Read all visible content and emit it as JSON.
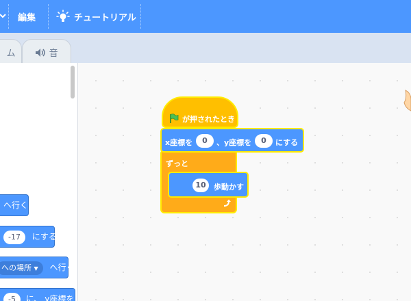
{
  "menu": {
    "edit_label": "編集",
    "tutorial_label": "チュートリアル"
  },
  "tabs": {
    "costume_label_partial": "ム",
    "sound_label": "音"
  },
  "palette": {
    "goto_partial": "へ行く",
    "set_value": "-17",
    "set_suffix": "にする",
    "random_dropdown": "への場所",
    "random_suffix": "へ行く",
    "glide_value": "-5",
    "glide_text": "に、 y座標を"
  },
  "script": {
    "hat_label": "が押されたとき",
    "goto_x_label": "x座標を",
    "goto_x_value": "0",
    "goto_sep": "、y座標を",
    "goto_y_value": "0",
    "goto_suffix": "にする",
    "forever_label": "ずっと",
    "move_value": "10",
    "move_label": "歩動かす"
  },
  "colors": {
    "menubar": "#4c97ff",
    "motion": "#4c97ff",
    "control": "#ffab19",
    "events": "#ffbf00",
    "highlight": "#ffeb00"
  }
}
